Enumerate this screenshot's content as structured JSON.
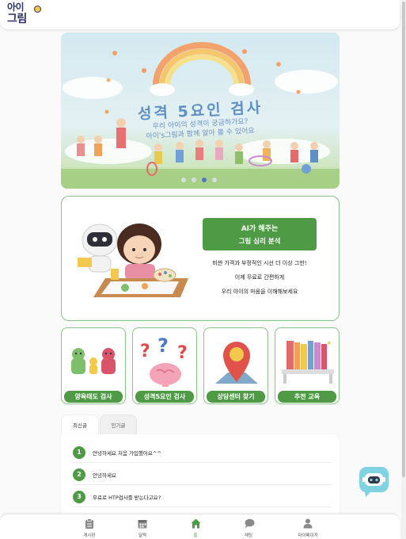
{
  "header": {
    "logo_line1": "아이",
    "logo_line2": "그림",
    "logo_badge": "S"
  },
  "banner": {
    "title": "성격 5요인 검사",
    "subtitle_line1": "우리 아이의 성격이 궁금하가요?",
    "subtitle_line2": "아이's그림과 함께 알아 볼 수 있어요",
    "slide_count": 4,
    "active_slide": 3
  },
  "ai_card": {
    "button_line1": "AI가 해주는",
    "button_line2": "그림 심리 분석",
    "desc_line1": "비싼 가격과 부정적인 시선 더 이상 그만!",
    "desc_line2": "이제 무료로 간편하게",
    "desc_line3": "우리 아이의 마음을 이해해보세요"
  },
  "categories": [
    {
      "label": "양육태도 검사",
      "icon": "family-figures-icon"
    },
    {
      "label": "성격5요인 검사",
      "icon": "brain-question-icon"
    },
    {
      "label": "상담센터 찾기",
      "icon": "map-pin-icon"
    },
    {
      "label": "추천 교육",
      "icon": "bookshelf-icon"
    }
  ],
  "board": {
    "tabs": [
      "최신글",
      "인기글"
    ],
    "active_tab": 0,
    "posts": [
      {
        "num": "1",
        "title": "안녕하세요 처음 가입했어요^^"
      },
      {
        "num": "2",
        "title": "안녕하세요"
      },
      {
        "num": "3",
        "title": "무료로 HTP검사를 받는다고요?"
      }
    ]
  },
  "bottom_nav": [
    {
      "label": "게시판",
      "icon": "clipboard-icon"
    },
    {
      "label": "달력",
      "icon": "calendar-icon"
    },
    {
      "label": "홈",
      "icon": "home-icon"
    },
    {
      "label": "채팅",
      "icon": "chat-bubble-icon"
    },
    {
      "label": "마이페이지",
      "icon": "user-icon"
    }
  ],
  "active_nav": 2,
  "colors": {
    "brand_green": "#4f9a45",
    "card_border": "#8bc48a",
    "banner_title": "#5f8fc3",
    "logo_navy": "#2b2f6b"
  },
  "chatbot": {
    "icon": "robot-chat-icon"
  }
}
